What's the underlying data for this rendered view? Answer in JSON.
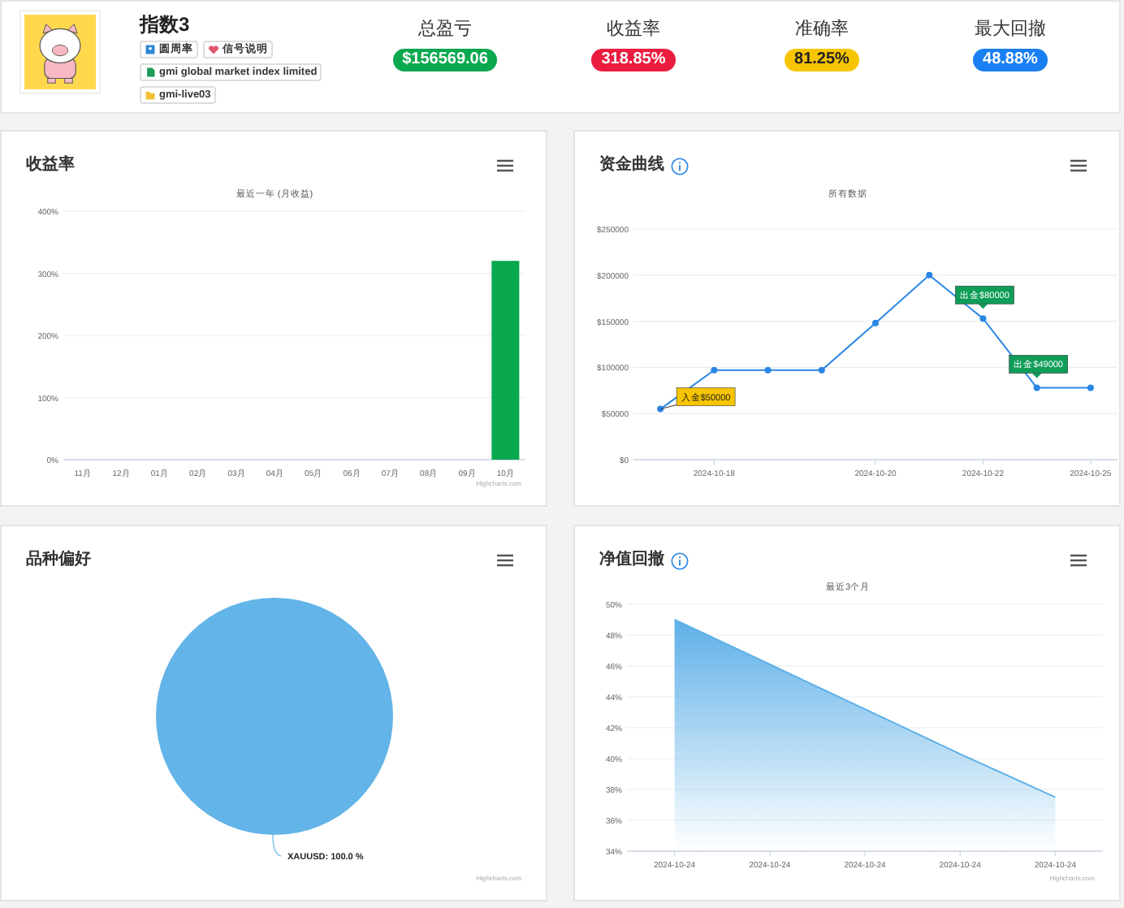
{
  "header": {
    "title": "指数3",
    "tags": [
      {
        "kind": "person",
        "text": "圆周率"
      },
      {
        "kind": "heart",
        "text": "信号说明"
      },
      {
        "kind": "document",
        "text": "gmi global market index limited"
      },
      {
        "kind": "folder",
        "text": "gmi-live03"
      }
    ],
    "stats": [
      {
        "label": "总盈亏",
        "value": "$156569.06",
        "color": "#0aa84f"
      },
      {
        "label": "收益率",
        "value": "318.85%",
        "color": "#ea1c40"
      },
      {
        "label": "准确率",
        "value": "81.25%",
        "color": "#f7c500"
      },
      {
        "label": "最大回撤",
        "value": "48.88%",
        "color": "#1a7ff2"
      }
    ]
  },
  "cards": [
    {
      "title": "收益率",
      "info": false,
      "subtitle": "最近一年 (月收益)",
      "credits": "Highcharts.com",
      "chart_data": {
        "type": "bar",
        "categories": [
          "11月",
          "12月",
          "01月",
          "02月",
          "03月",
          "04月",
          "05月",
          "06月",
          "07月",
          "08月",
          "09月",
          "10月"
        ],
        "series": [
          {
            "color": "#0aa84f",
            "values": [
              0,
              0,
              0,
              0,
              0,
              0,
              0,
              0,
              0,
              0,
              0,
              320
            ]
          }
        ],
        "grid": true,
        "ylim": [
          0,
          400
        ],
        "yticks": [
          {
            "value": 0,
            "label": "0%"
          },
          {
            "value": 100,
            "label": "100%"
          },
          {
            "value": 200,
            "label": "200%"
          },
          {
            "value": 300,
            "label": "300%"
          },
          {
            "value": 400,
            "label": "400%"
          }
        ]
      }
    },
    {
      "title": "资金曲线",
      "info": true,
      "subtitle": "所有数据",
      "annotation_styles": [
        {
          "kind": "deposit",
          "color": "#f7c500"
        },
        {
          "kind": "withdrawal",
          "color": "#0f9d58"
        },
        {
          "kind": "withdrawal",
          "color": "#0f9d58"
        }
      ],
      "chart_data": {
        "type": "line",
        "categories": [
          null,
          "2024-10-18",
          null,
          null,
          "2024-10-20",
          null,
          "2024-10-22",
          null,
          "2024-10-25"
        ],
        "series": [
          {
            "color": "#2a86e6",
            "marker": true,
            "values": [
              55000,
              97000,
              97000,
              97000,
              148000,
              200000,
              153000,
              78000,
              78000
            ]
          }
        ],
        "grid": true,
        "ylim": [
          0,
          250000
        ],
        "yticks": [
          {
            "value": 0,
            "label": "$0"
          },
          {
            "value": 50000,
            "label": "$50000"
          },
          {
            "value": 100000,
            "label": "$100000"
          },
          {
            "value": 150000,
            "label": "$150000"
          },
          {
            "value": 200000,
            "label": "$200000"
          },
          {
            "value": 250000,
            "label": "$250000"
          }
        ],
        "annotations": [
          "入金$50000",
          "出金$80000",
          "出金$49000"
        ]
      }
    },
    {
      "title": "品种偏好",
      "info": false,
      "credits": "Highcharts.com",
      "chart_data": {
        "type": "pie",
        "series": [
          {
            "color": "#63b4e8",
            "values": [
              100
            ]
          }
        ],
        "value_labels": [
          "XAUUSD: 100.0 %"
        ]
      }
    },
    {
      "title": "净值回撤",
      "info": true,
      "subtitle": "最近3个月",
      "credits": "Highcharts.com",
      "chart_data": {
        "type": "area",
        "categories": [
          "2024-10-24",
          "2024-10-24",
          "2024-10-24",
          "2024-10-24",
          "2024-10-24"
        ],
        "series": [
          {
            "color": "#5eb0e8",
            "values": [
              49,
              46.1,
              43.2,
              40.3,
              37.5
            ]
          }
        ],
        "grid": true,
        "ylim": [
          34,
          50
        ],
        "yticks": [
          {
            "value": 34,
            "label": "34%"
          },
          {
            "value": 36,
            "label": "36%"
          },
          {
            "value": 38,
            "label": "38%"
          },
          {
            "value": 40,
            "label": "40%"
          },
          {
            "value": 42,
            "label": "42%"
          },
          {
            "value": 44,
            "label": "44%"
          },
          {
            "value": 46,
            "label": "46%"
          },
          {
            "value": 48,
            "label": "48%"
          },
          {
            "value": 50,
            "label": "50%"
          }
        ]
      }
    }
  ]
}
